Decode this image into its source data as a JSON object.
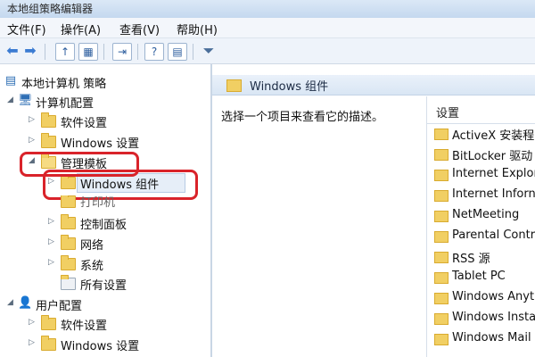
{
  "window": {
    "title": "本地组策略编辑器"
  },
  "menu": [
    {
      "label": "文件(F)"
    },
    {
      "label": "操作(A)"
    },
    {
      "label": "查看(V)"
    },
    {
      "label": "帮助(H)"
    }
  ],
  "toolbar": {
    "icons": [
      "back-arrow-icon",
      "forward-arrow-icon",
      "up-folder-icon",
      "show-tree-icon",
      "export-icon",
      "help-icon",
      "properties-icon",
      "filter-icon"
    ]
  },
  "tree": {
    "root": {
      "label": "本地计算机 策略"
    },
    "computer_config": {
      "label": "计算机配置"
    },
    "cc_software": {
      "label": "软件设置"
    },
    "cc_windows": {
      "label": "Windows 设置"
    },
    "admin_templates": {
      "label": "管理模板"
    },
    "windows_components": {
      "label": "Windows 组件"
    },
    "printers": {
      "label": "打印机"
    },
    "control_panel": {
      "label": "控制面板"
    },
    "network": {
      "label": "网络"
    },
    "system": {
      "label": "系统"
    },
    "all_settings": {
      "label": "所有设置"
    },
    "user_config": {
      "label": "用户配置"
    },
    "uc_software": {
      "label": "软件设置"
    },
    "uc_windows": {
      "label": "Windows 设置"
    }
  },
  "content": {
    "header": "Windows 组件",
    "description": "选择一个项目来查看它的描述。",
    "column_header": "设置",
    "items": [
      {
        "label": "ActiveX 安装程"
      },
      {
        "label": "BitLocker 驱动"
      },
      {
        "label": "Internet Explor"
      },
      {
        "label": "Internet Inforn"
      },
      {
        "label": "NetMeeting"
      },
      {
        "label": "Parental Contr"
      },
      {
        "label": "RSS 源"
      },
      {
        "label": "Tablet PC"
      },
      {
        "label": "Windows Anyti"
      },
      {
        "label": "Windows Insta"
      },
      {
        "label": "Windows Mail"
      }
    ]
  },
  "colors": {
    "highlight": "#d9232a",
    "folder": "#f1cf63"
  }
}
